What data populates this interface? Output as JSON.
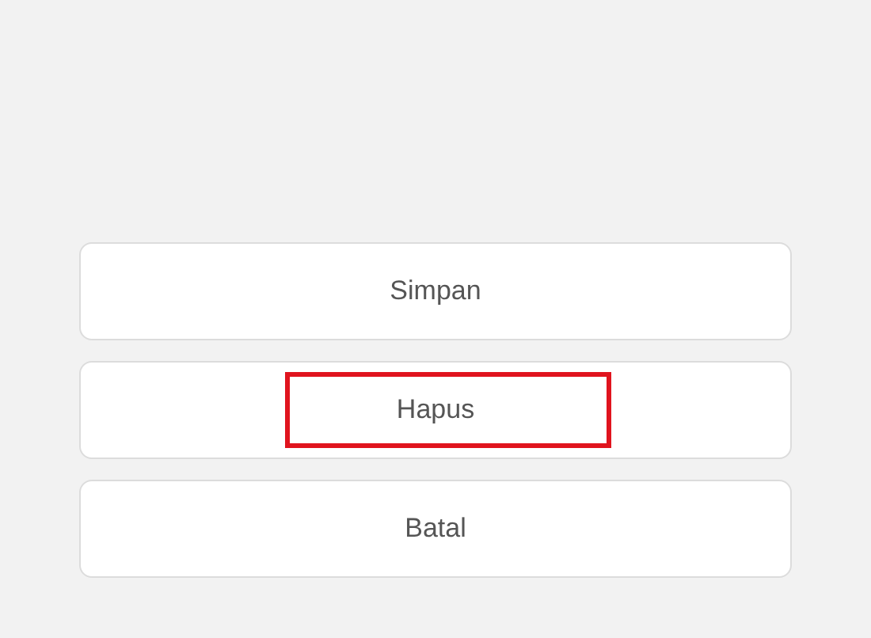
{
  "buttons": [
    {
      "label": "Simpan",
      "highlighted": false
    },
    {
      "label": "Hapus",
      "highlighted": true
    },
    {
      "label": "Batal",
      "highlighted": false
    }
  ]
}
